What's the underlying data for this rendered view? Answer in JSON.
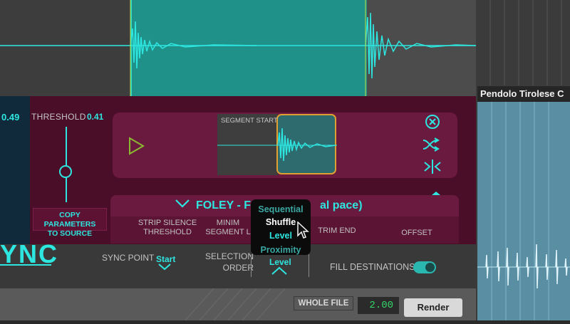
{
  "track": {
    "name": "Pendolo Tirolese C"
  },
  "plugin": {
    "left_value": "0.49",
    "threshold": {
      "label": "THRESHOLD",
      "value": "0.41"
    },
    "copy_button": {
      "line1": "COPY PARAMETERS",
      "line2": "TO SOURCE"
    },
    "segment_label": "SEGMENT START",
    "preset_name": "FOLEY - Fe",
    "preset_name_tail": "al pace)",
    "params": {
      "strip_line1": "STRIP SILENCE",
      "strip_line2": "THRESHOLD",
      "minseg_line1": "MINIM",
      "minseg_line2": "SEGMENT L",
      "trim_end": "TRIM END",
      "offset": "OFFSET"
    },
    "logo": "YNC",
    "sync_point": {
      "label": "SYNC POINT",
      "value": "Start"
    },
    "selection_order": {
      "line1": "SELECTION",
      "line2": "ORDER",
      "value": "Level"
    },
    "fill_destinations": {
      "label": "FILL DESTINATIONS",
      "enabled": true
    },
    "dropdown_options": [
      "Sequential",
      "Shuffle",
      "Level",
      "Proximity"
    ],
    "dropdown_hovered": "Shuffle",
    "dropdown_selected": "Level"
  },
  "render_bar": {
    "whole_file": "WHOLE FILE",
    "value": "2.00",
    "render": "Render"
  },
  "colors": {
    "accent": "#2ee6e0",
    "plugin_bg": "#4a0e28",
    "selection_border": "#e0a030"
  },
  "icons": [
    "play-icon",
    "close-icon",
    "shuffle-icon",
    "split-icon",
    "chevron-down-icon",
    "chevron-up-icon",
    "cursor-icon"
  ]
}
